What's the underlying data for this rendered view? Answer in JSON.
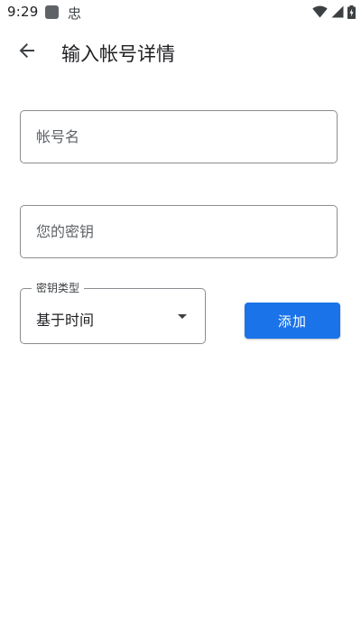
{
  "status_bar": {
    "time": "9:29",
    "app_icon": "app-square-icon",
    "notification_icon": "bug-icon",
    "notification_glyph": "忠",
    "wifi_icon": "wifi-icon",
    "signal_icon": "signal-icon",
    "battery_icon": "battery-charging-icon"
  },
  "app_bar": {
    "back_icon": "arrow-back-icon",
    "title": "输入帐号详情"
  },
  "form": {
    "account_name_placeholder": "帐号名",
    "account_name_value": "",
    "secret_key_placeholder": "您的密钥",
    "secret_key_value": "",
    "key_type_label": "密钥类型",
    "key_type_value": "基于时间",
    "add_button_label": "添加"
  },
  "colors": {
    "primary": "#1a73e8",
    "outline": "#8a8d91",
    "text": "#202124",
    "placeholder": "#5f6368"
  }
}
